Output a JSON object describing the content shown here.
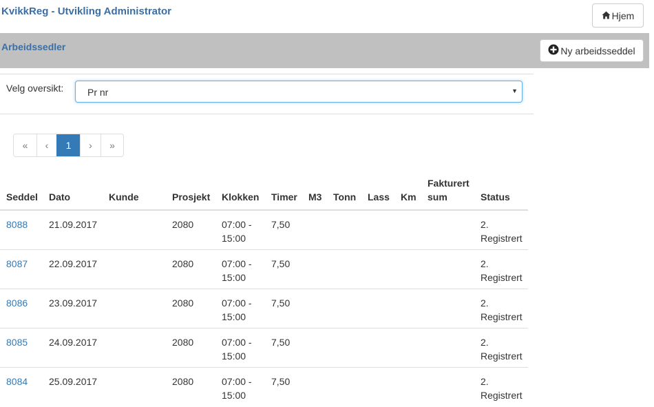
{
  "header": {
    "title": "KvikkReg - Utvikling Administrator",
    "home_button": "Hjem",
    "home_icon": "home-icon"
  },
  "section": {
    "title": "Arbeidssedler",
    "new_button": "Ny arbeidsseddel",
    "new_icon": "plus-circle-icon"
  },
  "filter": {
    "label": "Velg oversikt:",
    "selected": "Pr nr"
  },
  "pagination": {
    "first": "«",
    "prev": "‹",
    "current": "1",
    "next": "›",
    "last": "»"
  },
  "table": {
    "headers": {
      "seddel": "Seddel",
      "dato": "Dato",
      "kunde": "Kunde",
      "prosjekt": "Prosjekt",
      "klokken": "Klokken",
      "timer": "Timer",
      "m3": "M3",
      "tonn": "Tonn",
      "lass": "Lass",
      "km": "Km",
      "fakturert_line1": "Fakturert",
      "fakturert_line2": "sum",
      "status": "Status"
    },
    "rows": [
      {
        "seddel": "8088",
        "dato": "21.09.2017",
        "kunde": "",
        "prosjekt": "2080",
        "klokken_1": "07:00 -",
        "klokken_2": "15:00",
        "timer": "7,50",
        "m3": "",
        "tonn": "",
        "lass": "",
        "km": "",
        "fakturert": "",
        "status_1": "2.",
        "status_2": "Registrert"
      },
      {
        "seddel": "8087",
        "dato": "22.09.2017",
        "kunde": "",
        "prosjekt": "2080",
        "klokken_1": "07:00 -",
        "klokken_2": "15:00",
        "timer": "7,50",
        "m3": "",
        "tonn": "",
        "lass": "",
        "km": "",
        "fakturert": "",
        "status_1": "2.",
        "status_2": "Registrert"
      },
      {
        "seddel": "8086",
        "dato": "23.09.2017",
        "kunde": "",
        "prosjekt": "2080",
        "klokken_1": "07:00 -",
        "klokken_2": "15:00",
        "timer": "7,50",
        "m3": "",
        "tonn": "",
        "lass": "",
        "km": "",
        "fakturert": "",
        "status_1": "2.",
        "status_2": "Registrert"
      },
      {
        "seddel": "8085",
        "dato": "24.09.2017",
        "kunde": "",
        "prosjekt": "2080",
        "klokken_1": "07:00 -",
        "klokken_2": "15:00",
        "timer": "7,50",
        "m3": "",
        "tonn": "",
        "lass": "",
        "km": "",
        "fakturert": "",
        "status_1": "2.",
        "status_2": "Registrert"
      },
      {
        "seddel": "8084",
        "dato": "25.09.2017",
        "kunde": "",
        "prosjekt": "2080",
        "klokken_1": "07:00 -",
        "klokken_2": "15:00",
        "timer": "7,50",
        "m3": "",
        "tonn": "",
        "lass": "",
        "km": "",
        "fakturert": "",
        "status_1": "2.",
        "status_2": "Registrert"
      }
    ]
  },
  "colors": {
    "title_blue": "#3a6ea5",
    "link_blue": "#337ab7",
    "section_bar": "#c0c0c0"
  }
}
